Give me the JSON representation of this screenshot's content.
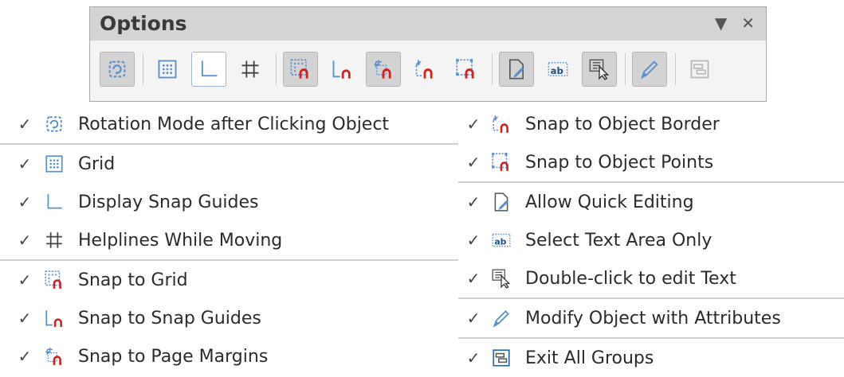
{
  "panel": {
    "title": "Options",
    "dropdown_glyph": "▼",
    "close_glyph": "✕"
  },
  "toolbar": {
    "buttons": [
      {
        "icon": "rotation-mode-icon",
        "state": "on"
      },
      {
        "icon": "grid-icon",
        "state": "off"
      },
      {
        "icon": "snap-guides-icon",
        "state": "selected"
      },
      {
        "icon": "helplines-icon",
        "state": "off"
      },
      {
        "icon": "snap-to-grid-icon",
        "state": "on"
      },
      {
        "icon": "snap-to-snap-guides-icon",
        "state": "off"
      },
      {
        "icon": "snap-to-page-margins-icon",
        "state": "on"
      },
      {
        "icon": "snap-to-object-border-icon",
        "state": "off"
      },
      {
        "icon": "snap-to-object-points-icon",
        "state": "off"
      },
      {
        "icon": "quick-editing-icon",
        "state": "on"
      },
      {
        "icon": "select-text-area-icon",
        "state": "off"
      },
      {
        "icon": "double-click-edit-icon",
        "state": "on"
      },
      {
        "icon": "modify-attributes-icon",
        "state": "on"
      },
      {
        "icon": "exit-groups-icon",
        "state": "disabled"
      }
    ]
  },
  "check_glyph": "✓",
  "menu": {
    "left": [
      {
        "label": "Rotation Mode after Clicking Object",
        "icon": "rotation-mode-icon",
        "checked": true
      },
      {
        "label": "Grid",
        "icon": "grid-icon",
        "checked": true
      },
      {
        "label": "Display Snap Guides",
        "icon": "snap-guides-icon",
        "checked": true
      },
      {
        "label": "Helplines While Moving",
        "icon": "helplines-icon",
        "checked": true
      },
      {
        "label": "Snap to Grid",
        "icon": "snap-to-grid-icon",
        "checked": true
      },
      {
        "label": "Snap to Snap Guides",
        "icon": "snap-to-snap-guides-icon",
        "checked": true
      },
      {
        "label": "Snap to Page Margins",
        "icon": "snap-to-page-margins-icon",
        "checked": true
      }
    ],
    "right": [
      {
        "label": "Snap to Object Border",
        "icon": "snap-to-object-border-icon",
        "checked": true
      },
      {
        "label": "Snap to Object Points",
        "icon": "snap-to-object-points-icon",
        "checked": true
      },
      {
        "label": "Allow Quick Editing",
        "icon": "quick-editing-icon",
        "checked": true
      },
      {
        "label": "Select Text Area Only",
        "icon": "select-text-area-icon",
        "checked": true
      },
      {
        "label": "Double-click to edit Text",
        "icon": "double-click-edit-icon",
        "checked": true
      },
      {
        "label": "Modify Object with Attributes",
        "icon": "modify-attributes-icon",
        "checked": true
      },
      {
        "label": "Exit All Groups",
        "icon": "exit-groups-icon",
        "checked": true
      }
    ]
  },
  "colors": {
    "accent_blue": "#5a8fd0",
    "magnet_red": "#d02020",
    "panel_header": "#d4d4d4"
  }
}
